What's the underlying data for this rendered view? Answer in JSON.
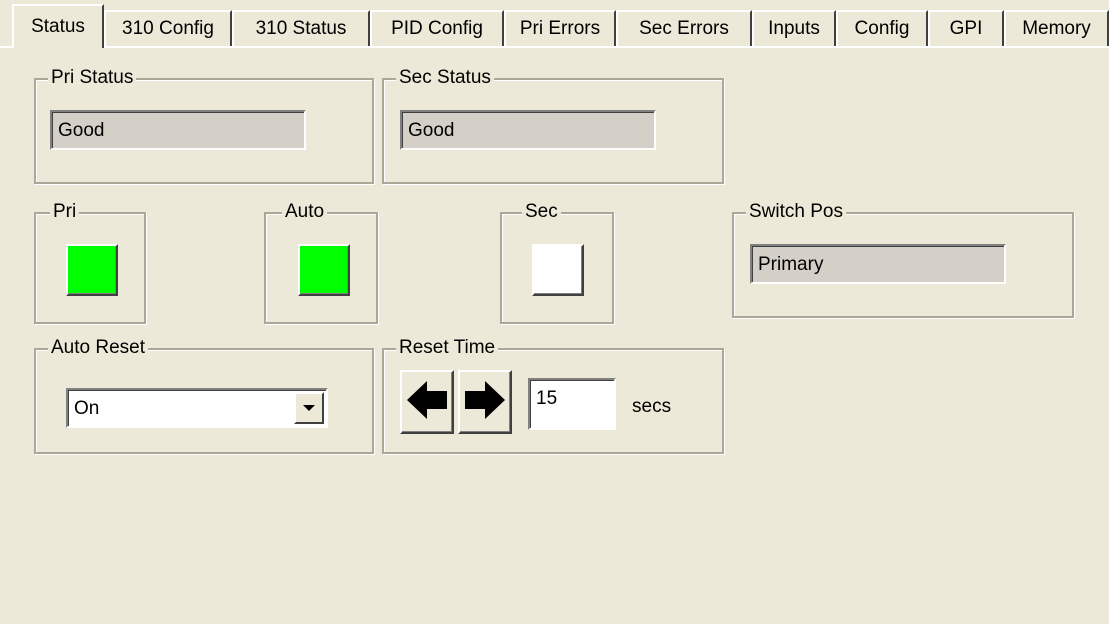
{
  "tabs": [
    {
      "label": "Status",
      "active": true
    },
    {
      "label": "310 Config"
    },
    {
      "label": "310 Status"
    },
    {
      "label": "PID Config"
    },
    {
      "label": "Pri Errors"
    },
    {
      "label": "Sec Errors"
    },
    {
      "label": "Inputs"
    },
    {
      "label": "Config"
    },
    {
      "label": "GPI"
    },
    {
      "label": "Memory"
    }
  ],
  "pri_status": {
    "label": "Pri Status",
    "value": "Good"
  },
  "sec_status": {
    "label": "Sec Status",
    "value": "Good"
  },
  "indicators": {
    "pri": {
      "label": "Pri",
      "color": "#00ff00"
    },
    "auto": {
      "label": "Auto",
      "color": "#00ff00"
    },
    "sec": {
      "label": "Sec",
      "color": "#ffffff"
    }
  },
  "switch_pos": {
    "label": "Switch Pos",
    "value": "Primary"
  },
  "auto_reset": {
    "label": "Auto Reset",
    "selected": "On"
  },
  "reset_time": {
    "label": "Reset Time",
    "value": "15",
    "unit": "secs"
  },
  "icons": {
    "left": "left-arrow-icon",
    "right": "right-arrow-icon",
    "dropdown": "chevron-down-icon"
  }
}
